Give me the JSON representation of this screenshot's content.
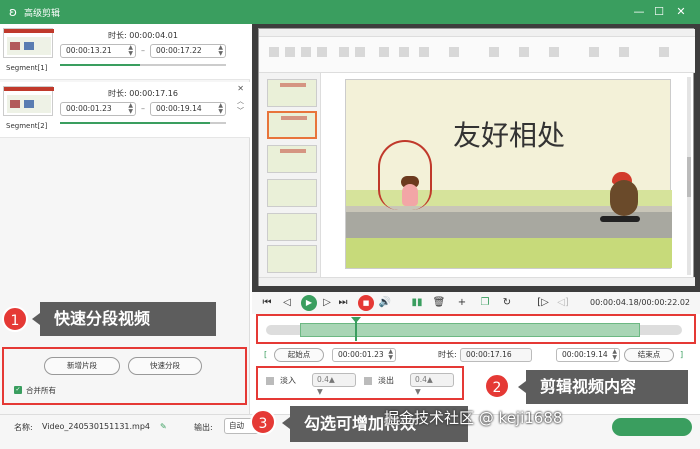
{
  "window": {
    "title": "高级剪辑",
    "controls": [
      "—",
      "☐",
      "✕"
    ]
  },
  "segments": [
    {
      "label": "Segment[1]",
      "duration_label": "时长:",
      "duration": "00:00:04.01",
      "start": "00:00:13.21",
      "end": "00:00:17.22"
    },
    {
      "label": "Segment[2]",
      "duration_label": "时长:",
      "duration": "00:00:17.16",
      "start": "00:00:01.23",
      "end": "00:00:19.14"
    }
  ],
  "left_controls": {
    "new_segment": "新增片段",
    "quick_split": "快速分段",
    "merge_all": "合并所有"
  },
  "callouts": [
    {
      "number": "1",
      "text": "快速分段视频"
    },
    {
      "number": "2",
      "text": "剪辑视频内容"
    },
    {
      "number": "3",
      "text": "勾选可增加特效"
    }
  ],
  "slide": {
    "title": "友好相处"
  },
  "player": {
    "timecode": "00:00:04.18/00:00:22.02"
  },
  "range": {
    "start_btn": "起始点",
    "start_value": "00:00:01.23",
    "duration_label": "时长:",
    "duration_value": "00:00:17.16",
    "end_value": "00:00:19.14",
    "end_btn": "结束点"
  },
  "fade": {
    "in_label": "淡入",
    "in_value": "0.4",
    "out_label": "淡出",
    "out_value": "0.4"
  },
  "bottom": {
    "name_label": "名称:",
    "file_name": "Video_240530151131.mp4",
    "output_label": "输出:",
    "output_value": "自动"
  },
  "watermark": "掘金技术社区 @ keji1688",
  "colors": {
    "accent": "#3a9e5f",
    "highlight": "#e53935",
    "callout": "#5d5d5d"
  }
}
